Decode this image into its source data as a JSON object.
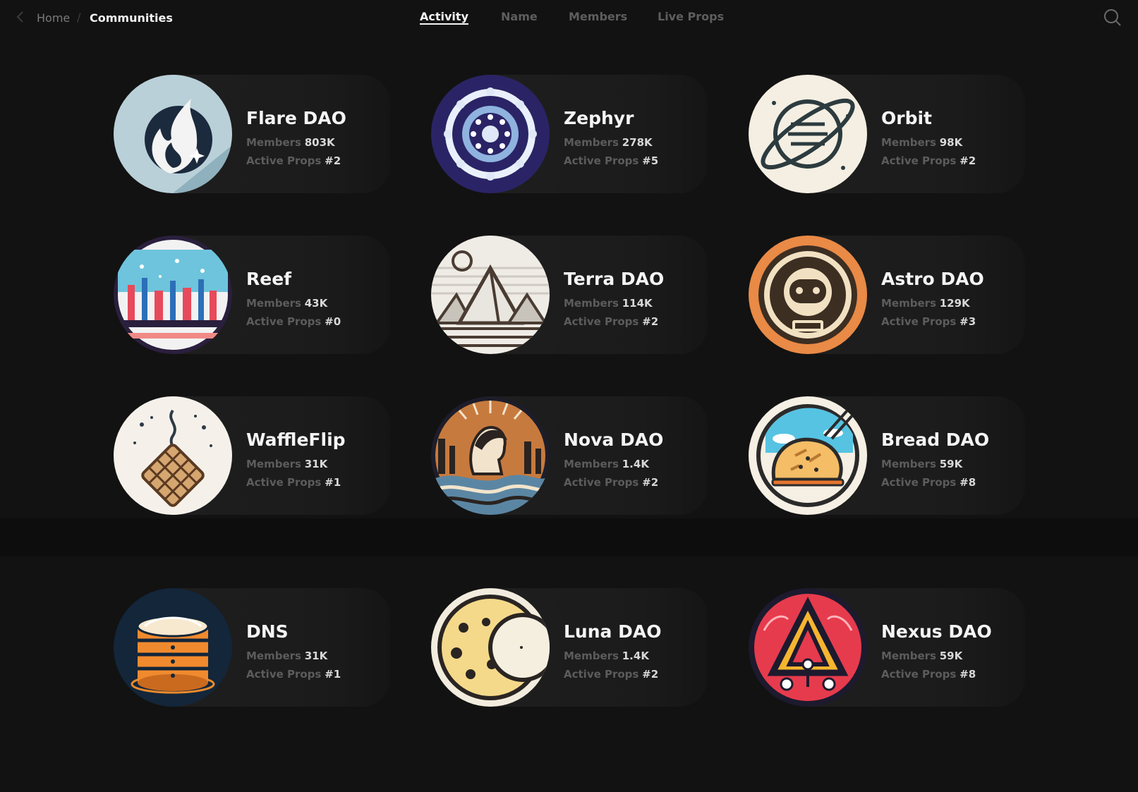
{
  "breadcrumb": {
    "back_icon": "chevron-left-icon",
    "home": "Home",
    "separator": "/",
    "current": "Communities"
  },
  "tabs": [
    {
      "label": "Activity",
      "active": true
    },
    {
      "label": "Name",
      "active": false
    },
    {
      "label": "Members",
      "active": false
    },
    {
      "label": "Live Props",
      "active": false
    }
  ],
  "search": {
    "icon": "search-icon"
  },
  "labels": {
    "members": "Members",
    "props": "Active Props"
  },
  "communities": [
    {
      "name": "Flare DAO",
      "members": "803K",
      "props": "#2",
      "icon": "flame-icon"
    },
    {
      "name": "Zephyr",
      "members": "278K",
      "props": "#5",
      "icon": "mandala-icon"
    },
    {
      "name": "Orbit",
      "members": "98K",
      "props": "#2",
      "icon": "planet-icon"
    },
    {
      "name": "Reef",
      "members": "43K",
      "props": "#0",
      "icon": "coral-reef-icon"
    },
    {
      "name": "Terra DAO",
      "members": "114K",
      "props": "#2",
      "icon": "pyramid-icon"
    },
    {
      "name": "Astro DAO",
      "members": "129K",
      "props": "#3",
      "icon": "astronaut-icon"
    },
    {
      "name": "WaffleFlip",
      "members": "31K",
      "props": "#1",
      "icon": "waffle-icon"
    },
    {
      "name": "Nova DAO",
      "members": "1.4K",
      "props": "#2",
      "icon": "portrait-icon"
    },
    {
      "name": "Bread DAO",
      "members": "59K",
      "props": "#8",
      "icon": "bread-icon"
    },
    {
      "name": "DNS",
      "members": "31K",
      "props": "#1",
      "icon": "database-icon"
    },
    {
      "name": "Luna DAO",
      "members": "1.4K",
      "props": "#2",
      "icon": "moon-icon"
    },
    {
      "name": "Nexus DAO",
      "members": "59K",
      "props": "#8",
      "icon": "triangle-network-icon"
    }
  ]
}
